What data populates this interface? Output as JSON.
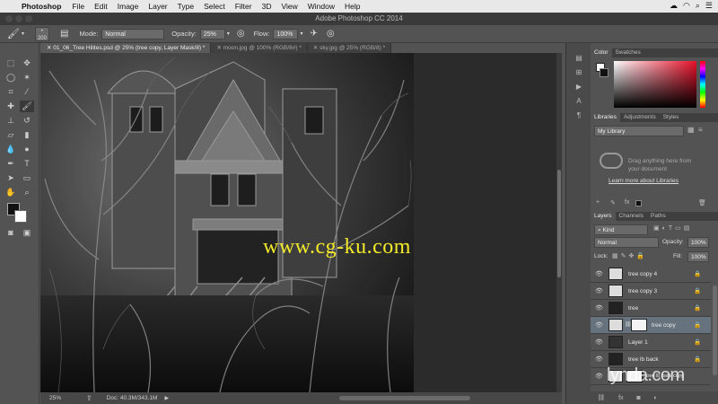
{
  "menubar": {
    "app": "Photoshop",
    "items": [
      "File",
      "Edit",
      "Image",
      "Layer",
      "Type",
      "Select",
      "Filter",
      "3D",
      "View",
      "Window",
      "Help"
    ]
  },
  "window_title": "Adobe Photoshop CC 2014",
  "options_bar": {
    "brush_size": "200",
    "mode_label": "Mode:",
    "mode_value": "Normal",
    "opacity_label": "Opacity:",
    "opacity_value": "25%",
    "flow_label": "Flow:",
    "flow_value": "100%"
  },
  "doc_tabs": [
    "01_06_Tree Hilites.psd @ 25% (tree copy, Layer Mask/8) *",
    "moon.jpg @ 100% (RGB/8#) *",
    "sky.jpg @ 25% (RGB/8) *"
  ],
  "watermark": "www.cg-ku.com",
  "status": {
    "zoom": "25%",
    "doc": "Doc: 40.3M/343.1M"
  },
  "color_panel": {
    "tabs": [
      "Color",
      "Swatches"
    ]
  },
  "libraries_panel": {
    "tabs": [
      "Libraries",
      "Adjustments",
      "Styles"
    ],
    "library_name": "My Library",
    "drag_text_1": "Drag anything here from",
    "drag_text_2": "your document",
    "learn_more": "Learn more about Libraries"
  },
  "layers_panel": {
    "tabs": [
      "Layers",
      "Channels",
      "Paths"
    ],
    "filter_kind": "Kind",
    "blend_mode": "Normal",
    "opacity_label": "Opacity:",
    "opacity_value": "100%",
    "lock_label": "Lock:",
    "fill_label": "Fill:",
    "fill_value": "100%",
    "layers": [
      {
        "name": "tree copy 4",
        "selected": false
      },
      {
        "name": "tree copy 3",
        "selected": false
      },
      {
        "name": "tree",
        "selected": false
      },
      {
        "name": "tree copy",
        "selected": true
      },
      {
        "name": "Layer 1",
        "selected": false
      },
      {
        "name": "tree lb back",
        "selected": false
      },
      {
        "name": "tree lb back copy",
        "selected": false
      }
    ]
  },
  "brand": "lynda.com",
  "colors": {
    "accent_yellow": "#f3ea2a",
    "selected_layer": "#66727e",
    "panel_bg": "#535353"
  }
}
